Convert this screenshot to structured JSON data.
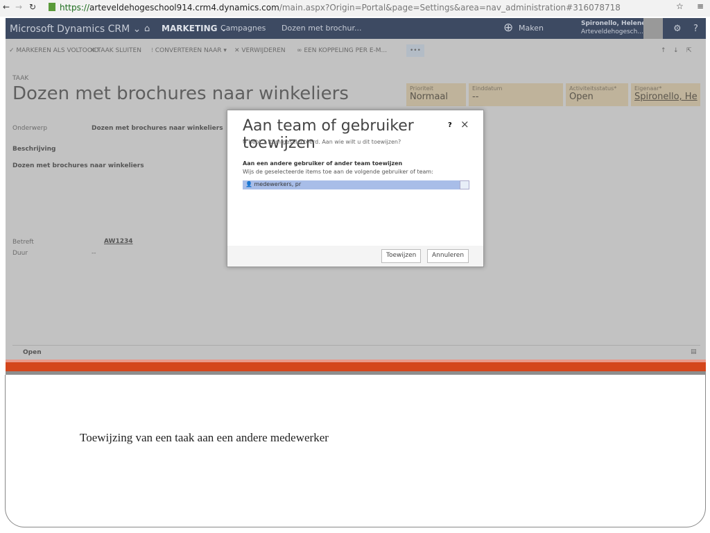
{
  "browser": {
    "url_scheme": "https://",
    "url_host": "arteveldehogeschool914.crm4.dynamics.com",
    "url_path": "/main.aspx?Origin=Portal&page=Settings&area=nav_administration#316078718"
  },
  "nav": {
    "app": "Microsoft Dynamics CRM ⌄",
    "area": "MARKETING ⌄",
    "crumb1": "Campagnes",
    "crumb2": "Dozen met brochur...",
    "create": "Maken",
    "user_name": "Spironello, Helene",
    "user_org": "Arteveldehogesch..."
  },
  "commands": [
    "✓ MARKEREN ALS VOLTOOID",
    "✕ TAAK SLUITEN",
    "⁝ CONVERTEREN NAAR ▾",
    "✕ VERWIJDEREN",
    "∞ EEN KOPPELING PER E-M...",
    "•••"
  ],
  "record": {
    "type": "TAAK",
    "title": "Dozen met brochures naar winkeliers",
    "header": [
      {
        "label": "Prioriteit",
        "value": "Normaal"
      },
      {
        "label": "Einddatum",
        "value": "--"
      },
      {
        "label": "Activiteitsstatus*",
        "value": "Open"
      },
      {
        "label": "Eigenaar*",
        "value": "Spironello, He"
      }
    ],
    "onderwerp_label": "Onderwerp",
    "onderwerp_value": "Dozen met brochures naar winkeliers",
    "beschrijving_label": "Beschrijving",
    "beschrijving_value": "Dozen met brochures naar winkeliers",
    "betreft_label": "Betreft",
    "betreft_value": "AW1234",
    "duur_label": "Duur",
    "duur_value": "--",
    "status": "Open"
  },
  "dialog": {
    "title": "Aan team of gebruiker toewijzen",
    "help": "?",
    "close": "×",
    "subtitle": "U hebt 1 item geselecteerd. Aan wie wilt u dit toewijzen?",
    "section": "Aan een andere gebruiker of ander team toewijzen",
    "instruction": "Wijs de geselecteerde items toe aan de volgende gebruiker of team:",
    "lookup_value": "medewerkers, pr",
    "assign": "Toewijzen",
    "cancel": "Annuleren"
  },
  "caption": "Toewijzing van een taak aan een andere medewerker"
}
